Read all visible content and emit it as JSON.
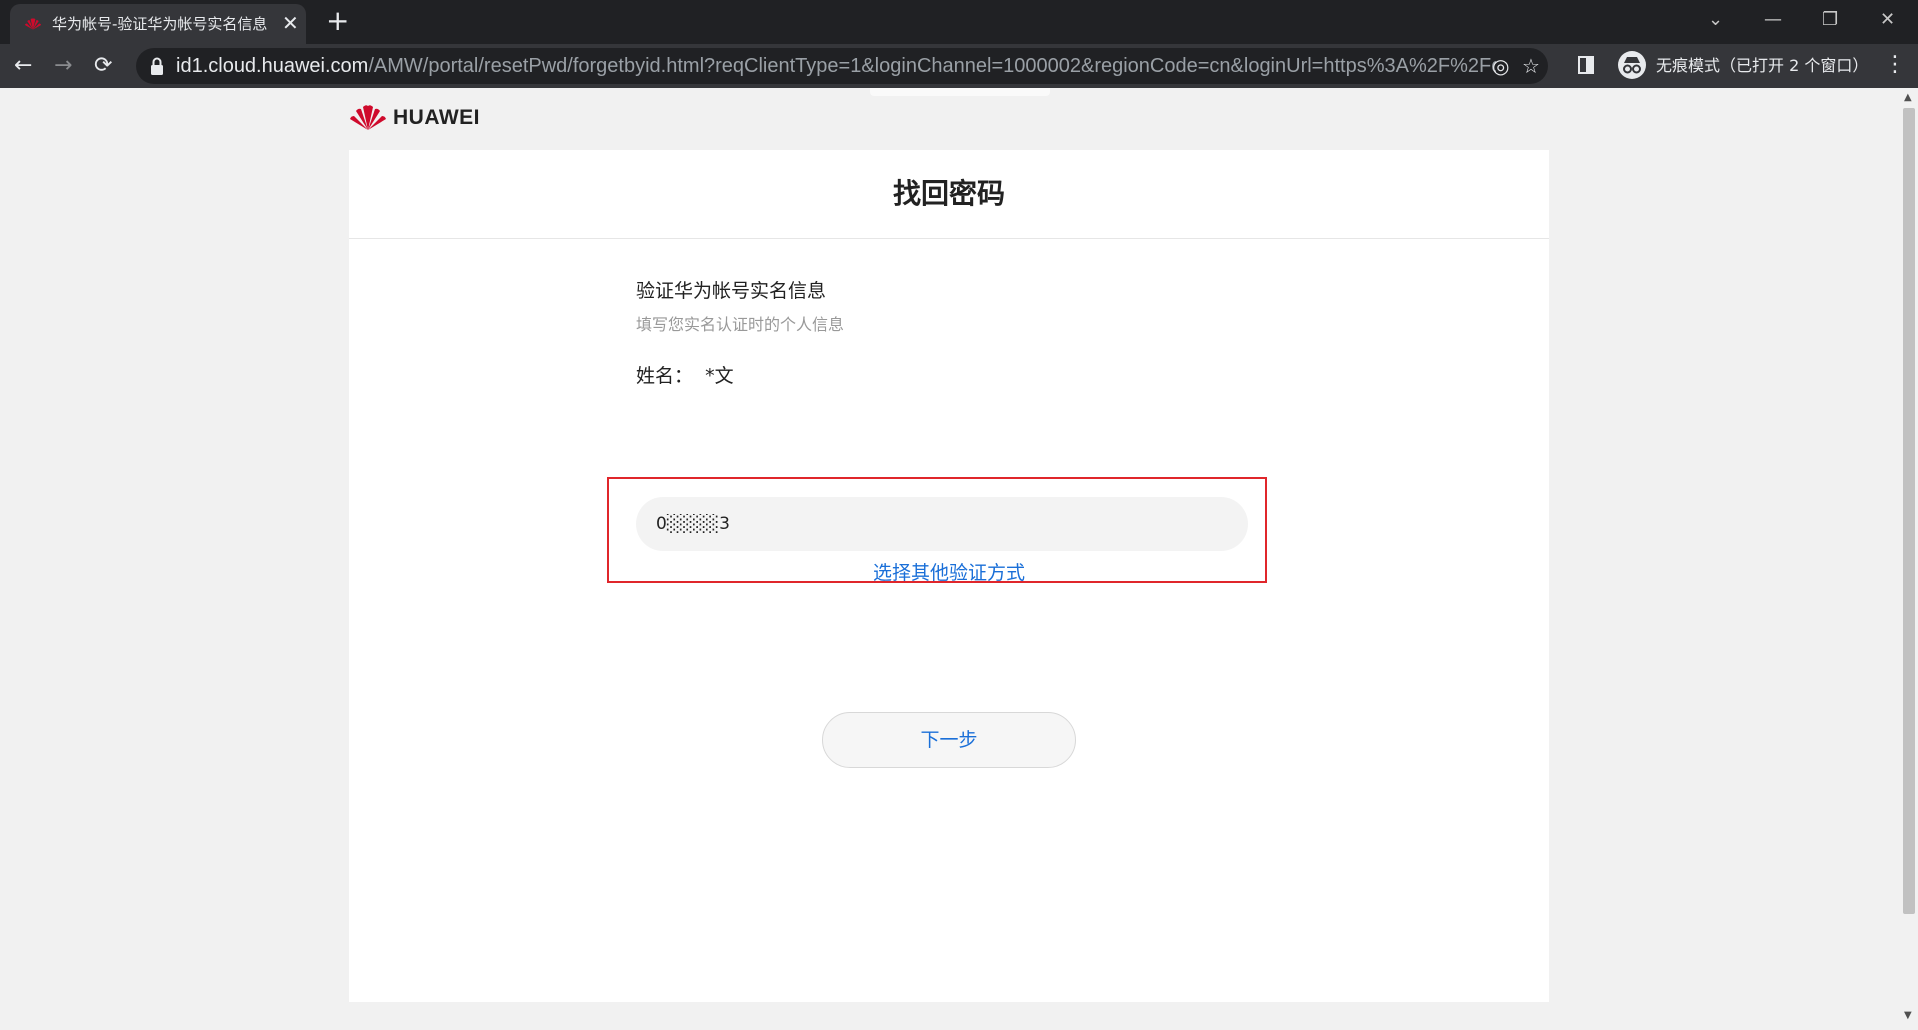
{
  "browser": {
    "tab_title": "华为帐号-验证华为帐号实名信息",
    "tab_close": "✕",
    "new_tab": "+",
    "url_host": "id1.cloud.huawei.com",
    "url_path": "/AMW/portal/resetPwd/forgetbyid.html?reqClientType=1&loginChannel=1000002&regionCode=cn&loginUrl=https%3A%2F%2Fcl...",
    "incognito_label": "无痕模式（已打开 2 个窗口）",
    "icons": {
      "back": "←",
      "forward": "→",
      "reload": "⟳",
      "eye_off": "◎",
      "star": "☆",
      "menu": "⋮",
      "chevron": "⌄",
      "minimize": "—",
      "restore": "❐",
      "close": "✕"
    }
  },
  "header": {
    "logo_text": "HUAWEI",
    "brand_color": "#cf0a2c"
  },
  "card": {
    "title": "找回密码",
    "section_title": "验证华为帐号实名信息",
    "section_subtitle": "填写您实名认证时的个人信息",
    "name_label": "姓名：  *文",
    "id_input_value": "0░░░░3",
    "alt_link": "选择其他验证方式",
    "next_button": "下一步"
  },
  "colors": {
    "link": "#1a6fd8",
    "highlight_border": "#e0262b"
  }
}
